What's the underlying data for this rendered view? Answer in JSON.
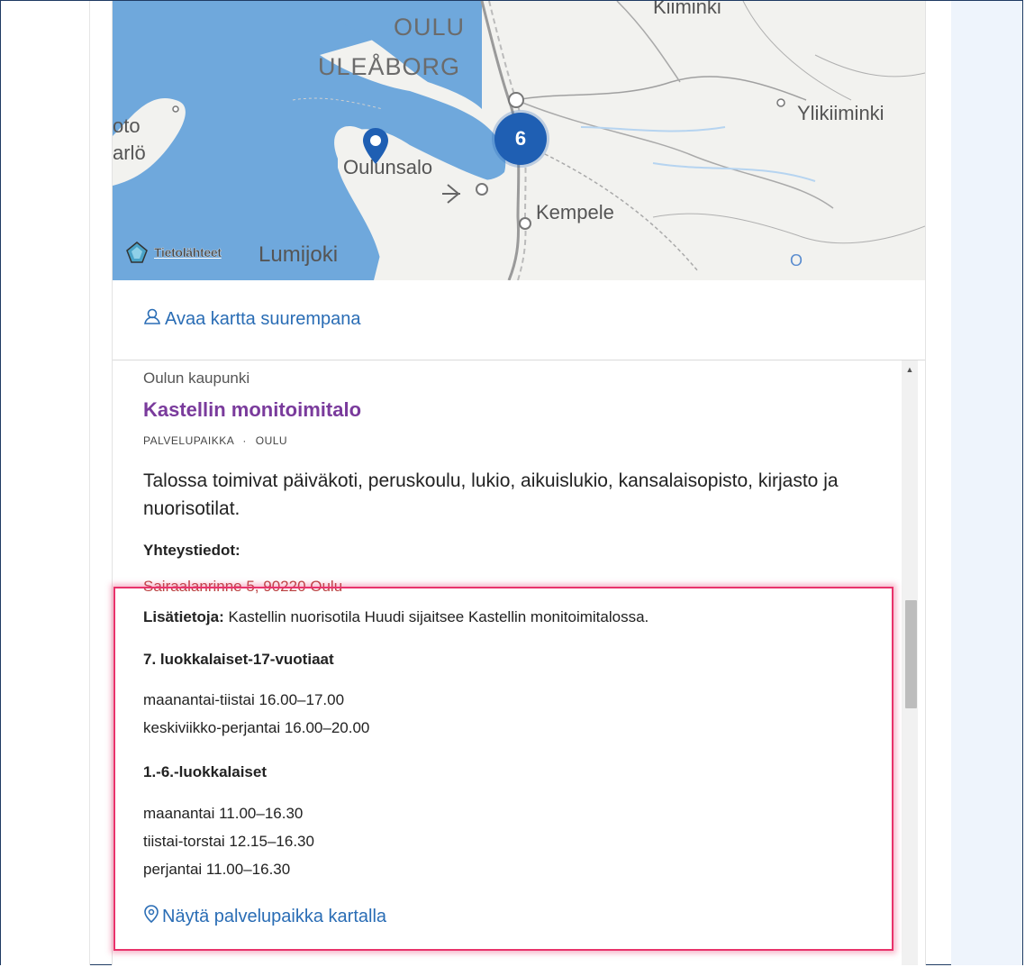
{
  "map": {
    "city_fi": "OULU",
    "city_sv": "ULEÅBORG",
    "labels": {
      "kiiminki": "Kiiminki",
      "ylikiiminki": "Ylikiiminki",
      "oulunsalo": "Oulunsalo",
      "kempele": "Kempele",
      "lumijoki": "Lumijoki",
      "left_top": "oto",
      "left_bottom": "arlö",
      "o_small": "O"
    },
    "cluster_count": "6",
    "attribution": "Tietolähteet",
    "colors": {
      "water": "#6fa8dc",
      "land": "#f2f2ef",
      "cluster": "#1f5fb3"
    }
  },
  "open_map_label": "Avaa kartta suurempana",
  "result": {
    "organization": "Oulun kaupunki",
    "title": "Kastellin monitoimitalo",
    "type": "PALVELUPAIKKA",
    "meta_sep": "·",
    "city": "OULU",
    "description": "Talossa toimivat päiväkoti, peruskoulu, lukio, aikuislukio, kansalaisopisto, kirjasto ja nuorisotilat.",
    "contact_heading": "Yhteystiedot:",
    "address": "Sairaalanrinne 5, 90220 Oulu",
    "info_label": "Lisätietoja:",
    "info_text": " Kastellin nuorisotila Huudi sijaitsee Kastellin monitoimitalossa.",
    "group1_heading": "7. luokkalaiset-17-vuotiaat",
    "group1_lines": [
      "maanantai-tiistai 16.00–17.00",
      "keskiviikko-perjantai 16.00–20.00"
    ],
    "group2_heading": "1.-6.-luokkalaiset",
    "group2_lines": [
      "maanantai 11.00–16.30",
      "tiistai-torstai 12.15–16.30",
      "perjantai 11.00–16.30"
    ],
    "show_on_map": "Näytä palvelupaikka kartalla"
  }
}
